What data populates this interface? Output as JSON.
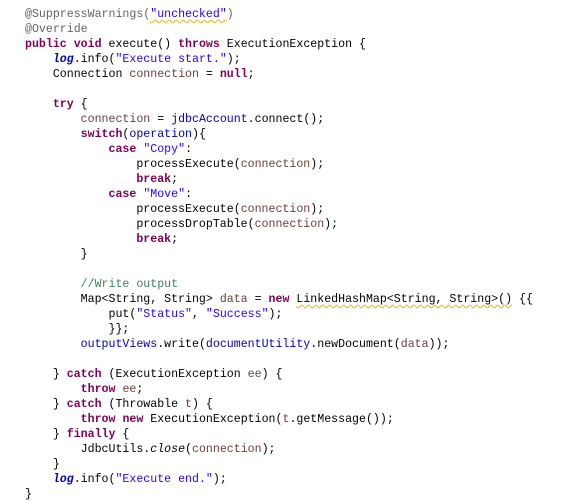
{
  "editor": {
    "lines": [
      [
        {
          "t": "@SuppressWarnings(",
          "c": "ann"
        },
        {
          "t": "\"unchecked\"",
          "c": "str warn"
        },
        {
          "t": ")",
          "c": "ann"
        }
      ],
      [
        {
          "t": "@Override",
          "c": "ann"
        }
      ],
      [
        {
          "t": "public",
          "c": "kw"
        },
        {
          "t": " "
        },
        {
          "t": "void",
          "c": "kw"
        },
        {
          "t": " execute() "
        },
        {
          "t": "throws",
          "c": "kw"
        },
        {
          "t": " ExecutionException {"
        }
      ],
      [
        {
          "t": "    "
        },
        {
          "t": "log",
          "c": "sfield"
        },
        {
          "t": ".info("
        },
        {
          "t": "\"Execute start.\"",
          "c": "str"
        },
        {
          "t": ");"
        }
      ],
      [
        {
          "t": "    Connection "
        },
        {
          "t": "connection",
          "c": "var"
        },
        {
          "t": " = "
        },
        {
          "t": "null",
          "c": "kw"
        },
        {
          "t": ";"
        }
      ],
      [],
      [
        {
          "t": "    "
        },
        {
          "t": "try",
          "c": "kw"
        },
        {
          "t": " {"
        }
      ],
      [
        {
          "t": "        "
        },
        {
          "t": "connection",
          "c": "var"
        },
        {
          "t": " = "
        },
        {
          "t": "jdbcAccount",
          "c": "fld"
        },
        {
          "t": ".connect();"
        }
      ],
      [
        {
          "t": "        "
        },
        {
          "t": "switch",
          "c": "kw"
        },
        {
          "t": "("
        },
        {
          "t": "operation",
          "c": "fld"
        },
        {
          "t": "){"
        }
      ],
      [
        {
          "t": "            "
        },
        {
          "t": "case",
          "c": "kw"
        },
        {
          "t": " "
        },
        {
          "t": "\"Copy\"",
          "c": "str"
        },
        {
          "t": ":"
        }
      ],
      [
        {
          "t": "                processExecute("
        },
        {
          "t": "connection",
          "c": "var"
        },
        {
          "t": ");"
        }
      ],
      [
        {
          "t": "                "
        },
        {
          "t": "break",
          "c": "kw"
        },
        {
          "t": ";"
        }
      ],
      [
        {
          "t": "            "
        },
        {
          "t": "case",
          "c": "kw"
        },
        {
          "t": " "
        },
        {
          "t": "\"Move\"",
          "c": "str"
        },
        {
          "t": ":"
        }
      ],
      [
        {
          "t": "                processExecute("
        },
        {
          "t": "connection",
          "c": "var"
        },
        {
          "t": ");"
        }
      ],
      [
        {
          "t": "                processDropTable("
        },
        {
          "t": "connection",
          "c": "var"
        },
        {
          "t": ");"
        }
      ],
      [
        {
          "t": "                "
        },
        {
          "t": "break",
          "c": "kw"
        },
        {
          "t": ";"
        }
      ],
      [
        {
          "t": "        }"
        }
      ],
      [],
      [
        {
          "t": "        "
        },
        {
          "t": "//Write output",
          "c": "cmt"
        }
      ],
      [
        {
          "t": "        Map<String, String> "
        },
        {
          "t": "data",
          "c": "var"
        },
        {
          "t": " = "
        },
        {
          "t": "new",
          "c": "kw"
        },
        {
          "t": " "
        },
        {
          "t": "LinkedHashMap<String, String>()",
          "c": "warn"
        },
        {
          "t": " {{"
        }
      ],
      [
        {
          "t": "            put("
        },
        {
          "t": "\"Status\"",
          "c": "str"
        },
        {
          "t": ", "
        },
        {
          "t": "\"Success\"",
          "c": "str"
        },
        {
          "t": ");"
        }
      ],
      [
        {
          "t": "            }};"
        }
      ],
      [
        {
          "t": "        "
        },
        {
          "t": "outputViews",
          "c": "fld"
        },
        {
          "t": ".write("
        },
        {
          "t": "documentUtility",
          "c": "fld"
        },
        {
          "t": ".newDocument("
        },
        {
          "t": "data",
          "c": "var"
        },
        {
          "t": "));"
        }
      ],
      [],
      [
        {
          "t": "    } "
        },
        {
          "t": "catch",
          "c": "kw"
        },
        {
          "t": " (ExecutionException "
        },
        {
          "t": "ee",
          "c": "var"
        },
        {
          "t": ") {"
        }
      ],
      [
        {
          "t": "        "
        },
        {
          "t": "throw",
          "c": "kw"
        },
        {
          "t": " "
        },
        {
          "t": "ee",
          "c": "var"
        },
        {
          "t": ";"
        }
      ],
      [
        {
          "t": "    } "
        },
        {
          "t": "catch",
          "c": "kw"
        },
        {
          "t": " (Throwable "
        },
        {
          "t": "t",
          "c": "var"
        },
        {
          "t": ") {"
        }
      ],
      [
        {
          "t": "        "
        },
        {
          "t": "throw",
          "c": "kw"
        },
        {
          "t": " "
        },
        {
          "t": "new",
          "c": "kw"
        },
        {
          "t": " ExecutionException("
        },
        {
          "t": "t",
          "c": "var"
        },
        {
          "t": ".getMessage());"
        }
      ],
      [
        {
          "t": "    } "
        },
        {
          "t": "finally",
          "c": "kw"
        },
        {
          "t": " {"
        }
      ],
      [
        {
          "t": "        JdbcUtils."
        },
        {
          "t": "close",
          "c": "ital"
        },
        {
          "t": "("
        },
        {
          "t": "connection",
          "c": "var"
        },
        {
          "t": ");"
        }
      ],
      [
        {
          "t": "    }"
        }
      ],
      [
        {
          "t": "    "
        },
        {
          "t": "log",
          "c": "sfield"
        },
        {
          "t": ".info("
        },
        {
          "t": "\"Execute end.\"",
          "c": "str"
        },
        {
          "t": ");"
        }
      ],
      [
        {
          "t": "}"
        }
      ]
    ]
  },
  "colors": {
    "keyword": "#7F0055",
    "string": "#2A00FF",
    "field": "#0000C0",
    "local_variable": "#6A3E3E",
    "annotation": "#646464",
    "comment": "#3F7F5F",
    "warning_underline": "#E0C040"
  }
}
